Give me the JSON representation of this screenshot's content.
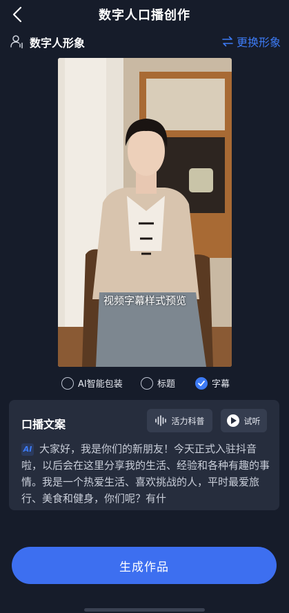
{
  "header": {
    "title": "数字人口播创作"
  },
  "avatar_section": {
    "label": "数字人形象",
    "switch_label": "更换形象"
  },
  "preview": {
    "subtitle_text": "视频字幕样式预览"
  },
  "options": [
    {
      "label": "AI智能包装",
      "checked": false
    },
    {
      "label": "标题",
      "checked": false
    },
    {
      "label": "字幕",
      "checked": true
    }
  ],
  "script_card": {
    "title": "口播文案",
    "voice_label": "活力科普",
    "listen_label": "试听",
    "ai_badge": "AI",
    "text": "大家好，我是你们的新朋友！今天正式入驻抖音啦，以后会在这里分享我的生活、经验和各种有趣的事情。我是一个热爱生活、喜欢挑战的人，平时最爱旅行、美食和健身，你们呢？有什"
  },
  "generate_button": {
    "label": "生成作品"
  },
  "colors": {
    "background": "#161c2a",
    "card": "#262d3d",
    "accent": "#3d7bf5",
    "button": "#3d6ff0"
  },
  "icons": [
    "back-arrow",
    "user-voice",
    "swap-arrows",
    "radio",
    "check",
    "audio-wave",
    "play"
  ]
}
